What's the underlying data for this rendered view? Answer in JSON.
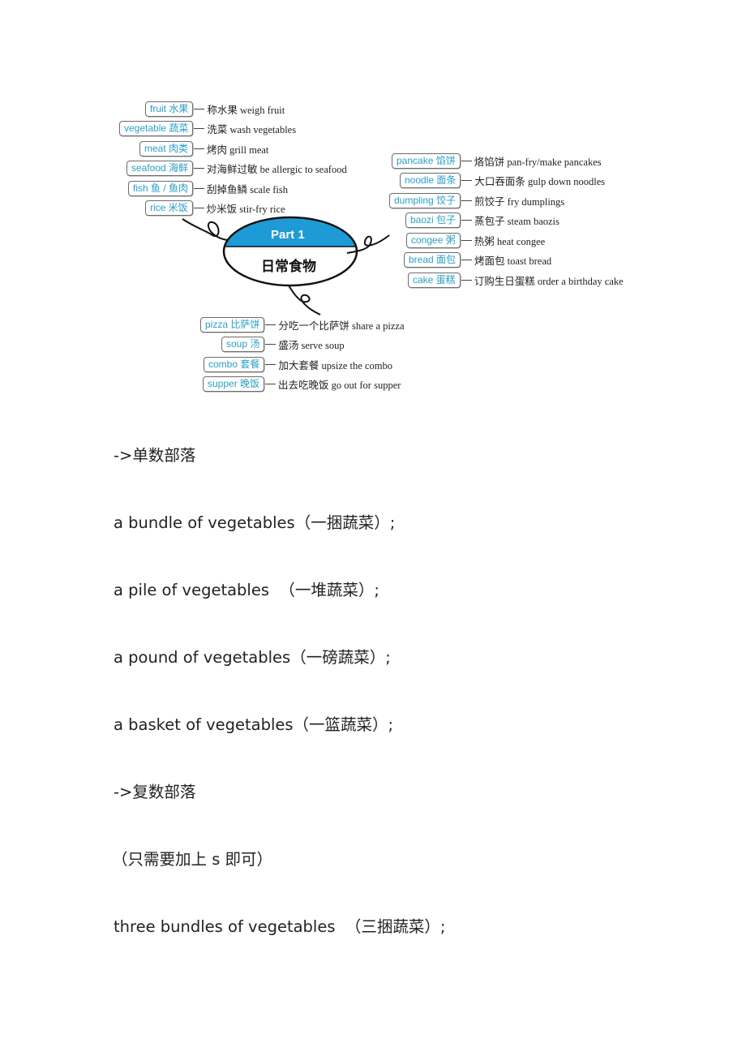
{
  "mindmap": {
    "center": {
      "title": "Part 1",
      "subtitle": "日常食物"
    },
    "colors": {
      "accent": "#1e9ad6",
      "pill_text": "#2a9fc6",
      "border": "#6b6b6b"
    },
    "left_items": [
      {
        "pill": "fruit 水果",
        "text": "称水果 weigh fruit"
      },
      {
        "pill": "vegetable 蔬菜",
        "text": "洗菜 wash vegetables"
      },
      {
        "pill": "meat 肉类",
        "text": "烤肉 grill meat"
      },
      {
        "pill": "seafood 海鲜",
        "text": "对海鲜过敏 be allergic to seafood"
      },
      {
        "pill": "fish 鱼 / 鱼肉",
        "text": "刮掉鱼鳞 scale fish"
      },
      {
        "pill": "rice 米饭",
        "text": "炒米饭 stir-fry rice"
      }
    ],
    "right_items": [
      {
        "pill": "pancake 馅饼",
        "text": "烙馅饼 pan-fry/make pancakes"
      },
      {
        "pill": "noodle 面条",
        "text": "大口吞面条 gulp down noodles"
      },
      {
        "pill": "dumpling 饺子",
        "text": "煎饺子 fry dumplings"
      },
      {
        "pill": "baozi 包子",
        "text": "蒸包子 steam baozis"
      },
      {
        "pill": "congee 粥",
        "text": "热粥 heat congee"
      },
      {
        "pill": "bread 面包",
        "text": "烤面包 toast bread"
      },
      {
        "pill": "cake 蛋糕",
        "text": "订购生日蛋糕 order a birthday cake"
      }
    ],
    "bottom_items": [
      {
        "pill": "pizza 比萨饼",
        "text": "分吃一个比萨饼 share a pizza"
      },
      {
        "pill": "soup 汤",
        "text": "盛汤 serve soup"
      },
      {
        "pill": "combo 套餐",
        "text": "加大套餐 upsize the combo"
      },
      {
        "pill": "supper 晚饭",
        "text": "出去吃晚饭 go out for supper"
      }
    ]
  },
  "body": {
    "paragraphs": [
      "->单数部落",
      "a bundle of vegetables（一捆蔬菜）;",
      "a pile of vegetables  （一堆蔬菜）;",
      "a pound of vegetables（一磅蔬菜）;",
      "a basket of vegetables（一篮蔬菜）;",
      "->复数部落",
      "（只需要加上 s 即可）",
      "three bundles of vegetables  （三捆蔬菜）;"
    ]
  }
}
